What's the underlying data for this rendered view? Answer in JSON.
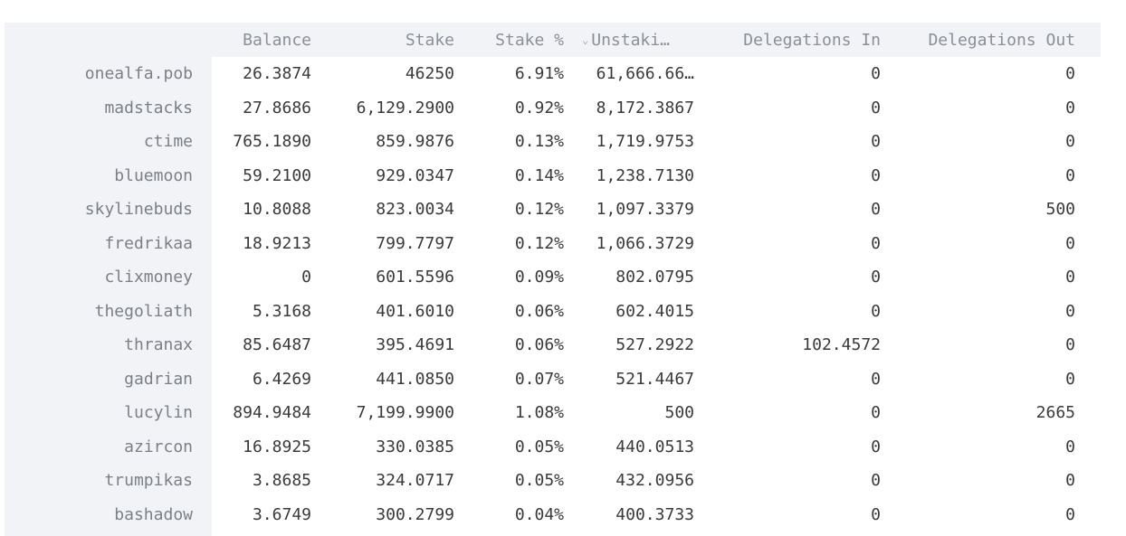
{
  "table": {
    "columns": [
      "",
      "Balance",
      "Stake",
      "Stake %",
      "Unstaki…",
      "Delegations In",
      "Delegations Out"
    ],
    "sorted_column_icon": "chevron-down-icon",
    "rows": [
      [
        "onealfa.pob",
        "26.3874",
        "46250",
        "6.91%",
        "61,666.66…",
        "0",
        "0"
      ],
      [
        "madstacks",
        "27.8686",
        "6,129.2900",
        "0.92%",
        "8,172.3867",
        "0",
        "0"
      ],
      [
        "ctime",
        "765.1890",
        "859.9876",
        "0.13%",
        "1,719.9753",
        "0",
        "0"
      ],
      [
        "bluemoon",
        "59.2100",
        "929.0347",
        "0.14%",
        "1,238.7130",
        "0",
        "0"
      ],
      [
        "skylinebuds",
        "10.8088",
        "823.0034",
        "0.12%",
        "1,097.3379",
        "0",
        "500"
      ],
      [
        "fredrikaa",
        "18.9213",
        "799.7797",
        "0.12%",
        "1,066.3729",
        "0",
        "0"
      ],
      [
        "clixmoney",
        "0",
        "601.5596",
        "0.09%",
        "802.0795",
        "0",
        "0"
      ],
      [
        "thegoliath",
        "5.3168",
        "401.6010",
        "0.06%",
        "602.4015",
        "0",
        "0"
      ],
      [
        "thranax",
        "85.6487",
        "395.4691",
        "0.06%",
        "527.2922",
        "102.4572",
        "0"
      ],
      [
        "gadrian",
        "6.4269",
        "441.0850",
        "0.07%",
        "521.4467",
        "0",
        "0"
      ],
      [
        "lucylin",
        "894.9484",
        "7,199.9900",
        "1.08%",
        "500",
        "0",
        "2665"
      ],
      [
        "azircon",
        "16.8925",
        "330.0385",
        "0.05%",
        "440.0513",
        "0",
        "0"
      ],
      [
        "trumpikas",
        "3.8685",
        "324.0717",
        "0.05%",
        "432.0956",
        "0",
        "0"
      ],
      [
        "bashadow",
        "3.6749",
        "300.2799",
        "0.04%",
        "400.3733",
        "0",
        "0"
      ]
    ]
  }
}
